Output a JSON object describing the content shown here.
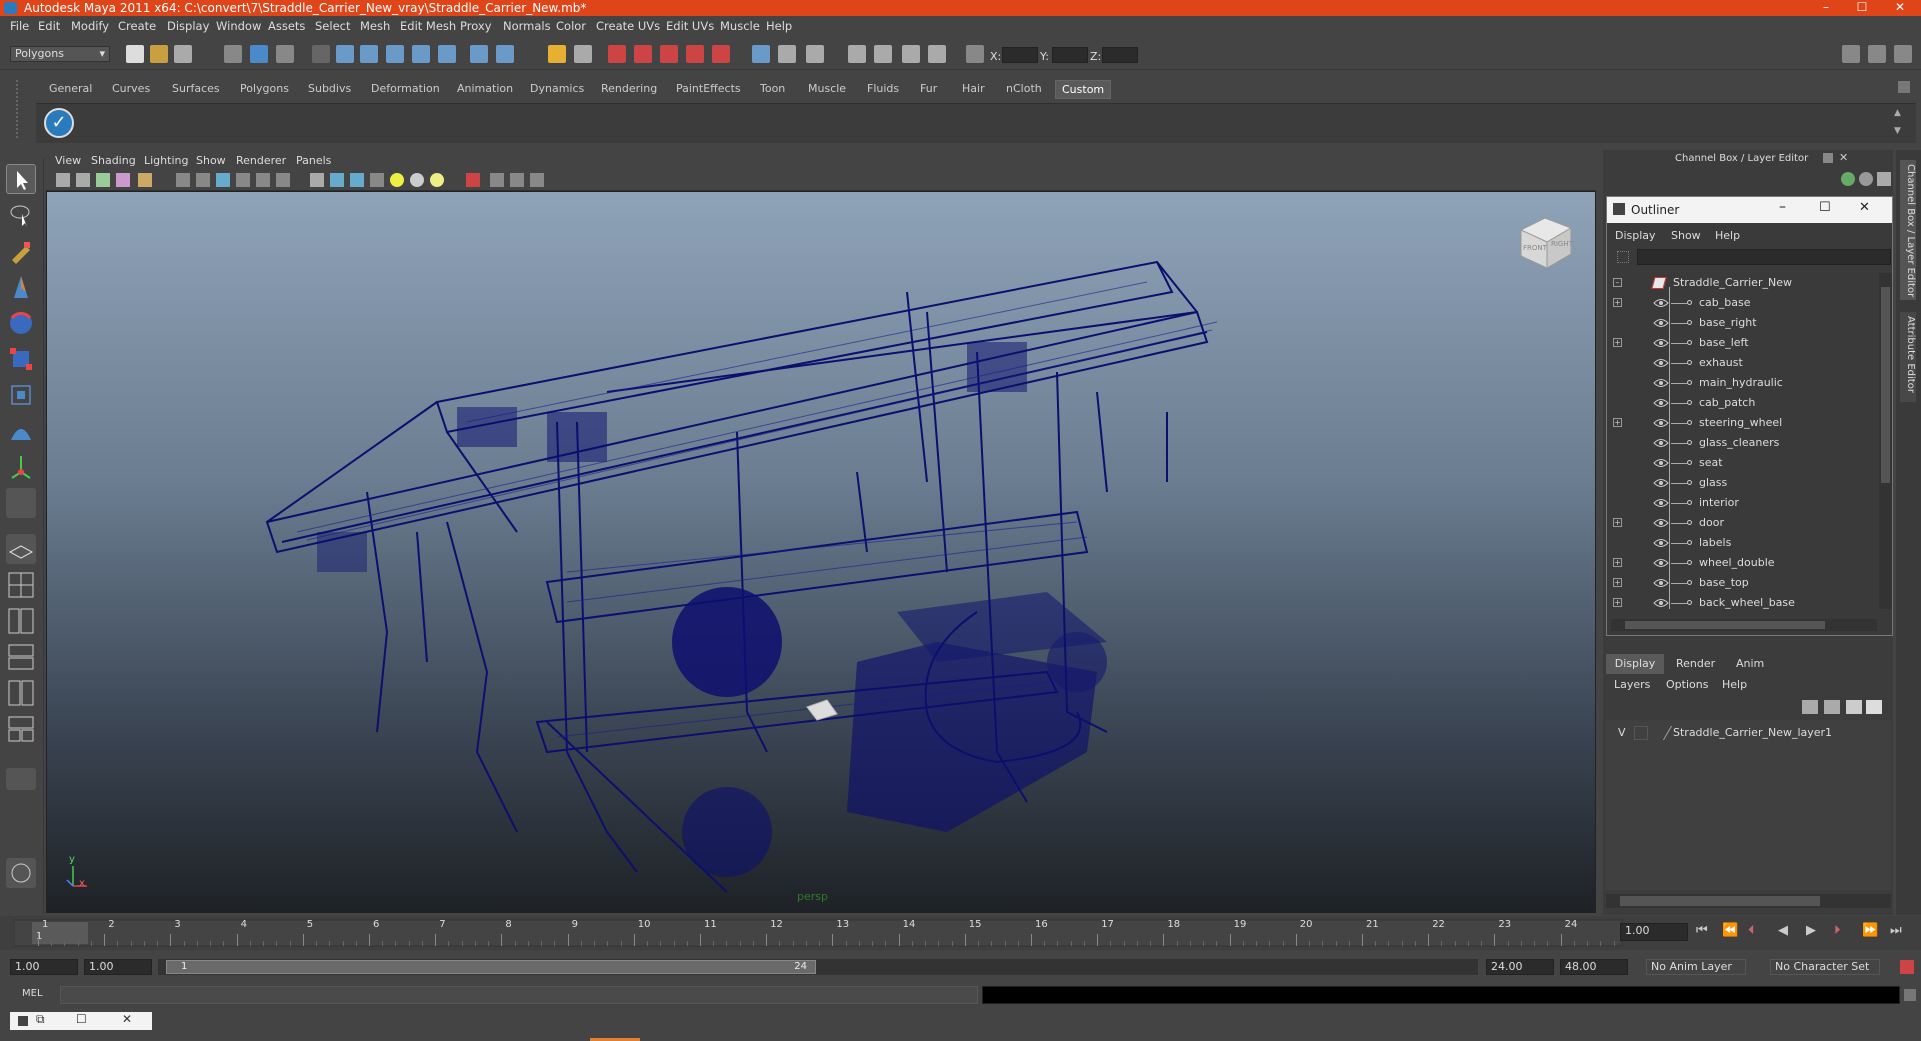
{
  "window": {
    "title": "Autodesk Maya 2011 x64: C:\\convert\\7\\Straddle_Carrier_New_vray\\Straddle_Carrier_New.mb*",
    "controls": [
      "–",
      "☐",
      "✕"
    ]
  },
  "menubar": [
    "File",
    "Edit",
    "Modify",
    "Create",
    "Display",
    "Window",
    "Assets",
    "Select",
    "Mesh",
    "Edit Mesh",
    "Proxy",
    "Normals",
    "Color",
    "Create UVs",
    "Edit UVs",
    "Muscle",
    "Help"
  ],
  "statusline": {
    "mode": "Polygons",
    "x_label": "X:",
    "y_label": "Y:",
    "z_label": "Z:"
  },
  "shelf_tabs": [
    "General",
    "Curves",
    "Surfaces",
    "Polygons",
    "Subdivs",
    "Deformation",
    "Animation",
    "Dynamics",
    "Rendering",
    "PaintEffects",
    "Toon",
    "Muscle",
    "Fluids",
    "Fur",
    "Hair",
    "nCloth",
    "Custom"
  ],
  "shelf_active": "Custom",
  "viewport": {
    "menus": [
      "View",
      "Shading",
      "Lighting",
      "Show",
      "Renderer",
      "Panels"
    ],
    "camera_label": "persp",
    "viewcube": {
      "front": "FRONT",
      "right": "RIGHT"
    },
    "axis": {
      "x": "x",
      "y": "y"
    }
  },
  "channel_box": {
    "title": "Channel Box / Layer Editor"
  },
  "outliner": {
    "title": "Outliner",
    "menus": [
      "Display",
      "Show",
      "Help"
    ],
    "root": "Straddle_Carrier_New",
    "items": [
      {
        "label": "cab_base",
        "expandable": true
      },
      {
        "label": "base_right",
        "expandable": false
      },
      {
        "label": "base_left",
        "expandable": true
      },
      {
        "label": "exhaust",
        "expandable": false
      },
      {
        "label": "main_hydraulic",
        "expandable": false
      },
      {
        "label": "cab_patch",
        "expandable": false
      },
      {
        "label": "steering_wheel",
        "expandable": true
      },
      {
        "label": "glass_cleaners",
        "expandable": false
      },
      {
        "label": "seat",
        "expandable": false
      },
      {
        "label": "glass",
        "expandable": false
      },
      {
        "label": "interior",
        "expandable": false
      },
      {
        "label": "door",
        "expandable": true
      },
      {
        "label": "labels",
        "expandable": false
      },
      {
        "label": "wheel_double",
        "expandable": true
      },
      {
        "label": "base_top",
        "expandable": true
      },
      {
        "label": "back_wheel_base",
        "expandable": true
      }
    ]
  },
  "layer_editor": {
    "tabs": [
      "Display",
      "Render",
      "Anim"
    ],
    "active_tab": "Display",
    "menus": [
      "Layers",
      "Options",
      "Help"
    ],
    "layers": [
      {
        "visible": "V",
        "name": "Straddle_Carrier_New_layer1"
      }
    ]
  },
  "side_tabs": [
    "Channel Box / Layer Editor",
    "Attribute Editor"
  ],
  "timeline": {
    "ticks": [
      "1",
      "2",
      "3",
      "4",
      "5",
      "6",
      "7",
      "8",
      "9",
      "10",
      "11",
      "12",
      "13",
      "14",
      "15",
      "16",
      "17",
      "18",
      "19",
      "20",
      "21",
      "22",
      "23",
      "24"
    ],
    "current_frame_marker": "1",
    "current_time": "1.00"
  },
  "range": {
    "start": "1.00",
    "playback_start": "1.00",
    "slider_start": "1",
    "slider_end": "24",
    "playback_end": "24.00",
    "end": "48.00",
    "anim_layer": "No Anim Layer",
    "character_set": "No Character Set"
  },
  "cmdline": {
    "label": "MEL"
  },
  "colors": {
    "title_bar": "#e0451a",
    "wireframe": "#0d0f6e",
    "accent": "#2a7bbd"
  }
}
